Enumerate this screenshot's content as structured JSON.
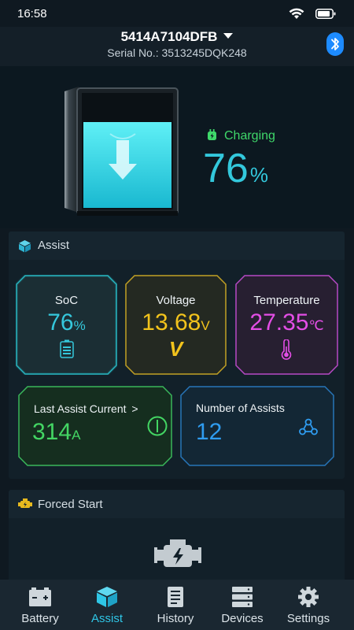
{
  "status_bar": {
    "time": "16:58"
  },
  "header": {
    "device_name": "5414A7104DFB",
    "serial_label": "Serial No.:",
    "serial_value": "3513245DQK248"
  },
  "hero": {
    "status_text": "Charging",
    "percent_value": "76",
    "percent_unit": "%",
    "charge_level": 0.76
  },
  "assist": {
    "title": "Assist",
    "soc": {
      "label": "SoC",
      "value": "76",
      "unit": "%"
    },
    "voltage": {
      "label": "Voltage",
      "value": "13.68",
      "unit": "V",
      "glyph": "V"
    },
    "temperature": {
      "label": "Temperature",
      "value": "27.35",
      "unit": "℃"
    },
    "last_current": {
      "label": "Last Assist Current",
      "arrow": ">",
      "value": "314",
      "unit": "A"
    },
    "assists": {
      "label": "Number of Assists",
      "value": "12"
    }
  },
  "forced_start": {
    "title": "Forced Start"
  },
  "nav": {
    "items": [
      {
        "label": "Battery",
        "icon": "battery-icon"
      },
      {
        "label": "Assist",
        "icon": "cube-icon"
      },
      {
        "label": "History",
        "icon": "history-icon"
      },
      {
        "label": "Devices",
        "icon": "devices-icon"
      },
      {
        "label": "Settings",
        "icon": "gear-icon"
      }
    ],
    "active_index": 1
  },
  "colors": {
    "accent_cyan": "#33c8dc",
    "charging_green": "#3fd86a",
    "voltage_yellow": "#f2c31c",
    "temperature_magenta": "#e44ee6",
    "current_green": "#43d563",
    "assists_blue": "#2f9cf0",
    "bluetooth_blue": "#1d8bff"
  }
}
